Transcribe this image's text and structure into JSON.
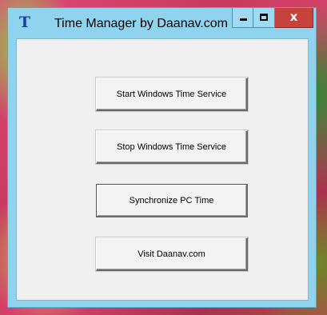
{
  "window": {
    "title": "Time Manager by Daanav.com",
    "icon": "T",
    "controls": {
      "minimize": "minimize-icon",
      "maximize": "maximize-icon",
      "close_label": "x"
    }
  },
  "buttons": {
    "start": "Start Windows Time Service",
    "stop": "Stop Windows Time Service",
    "sync": "Synchronize PC Time",
    "visit": "Visit Daanav.com"
  },
  "colors": {
    "titlebar": "#8fd3ef",
    "close_button": "#c5433a",
    "client_background": "#f0f0f0"
  }
}
